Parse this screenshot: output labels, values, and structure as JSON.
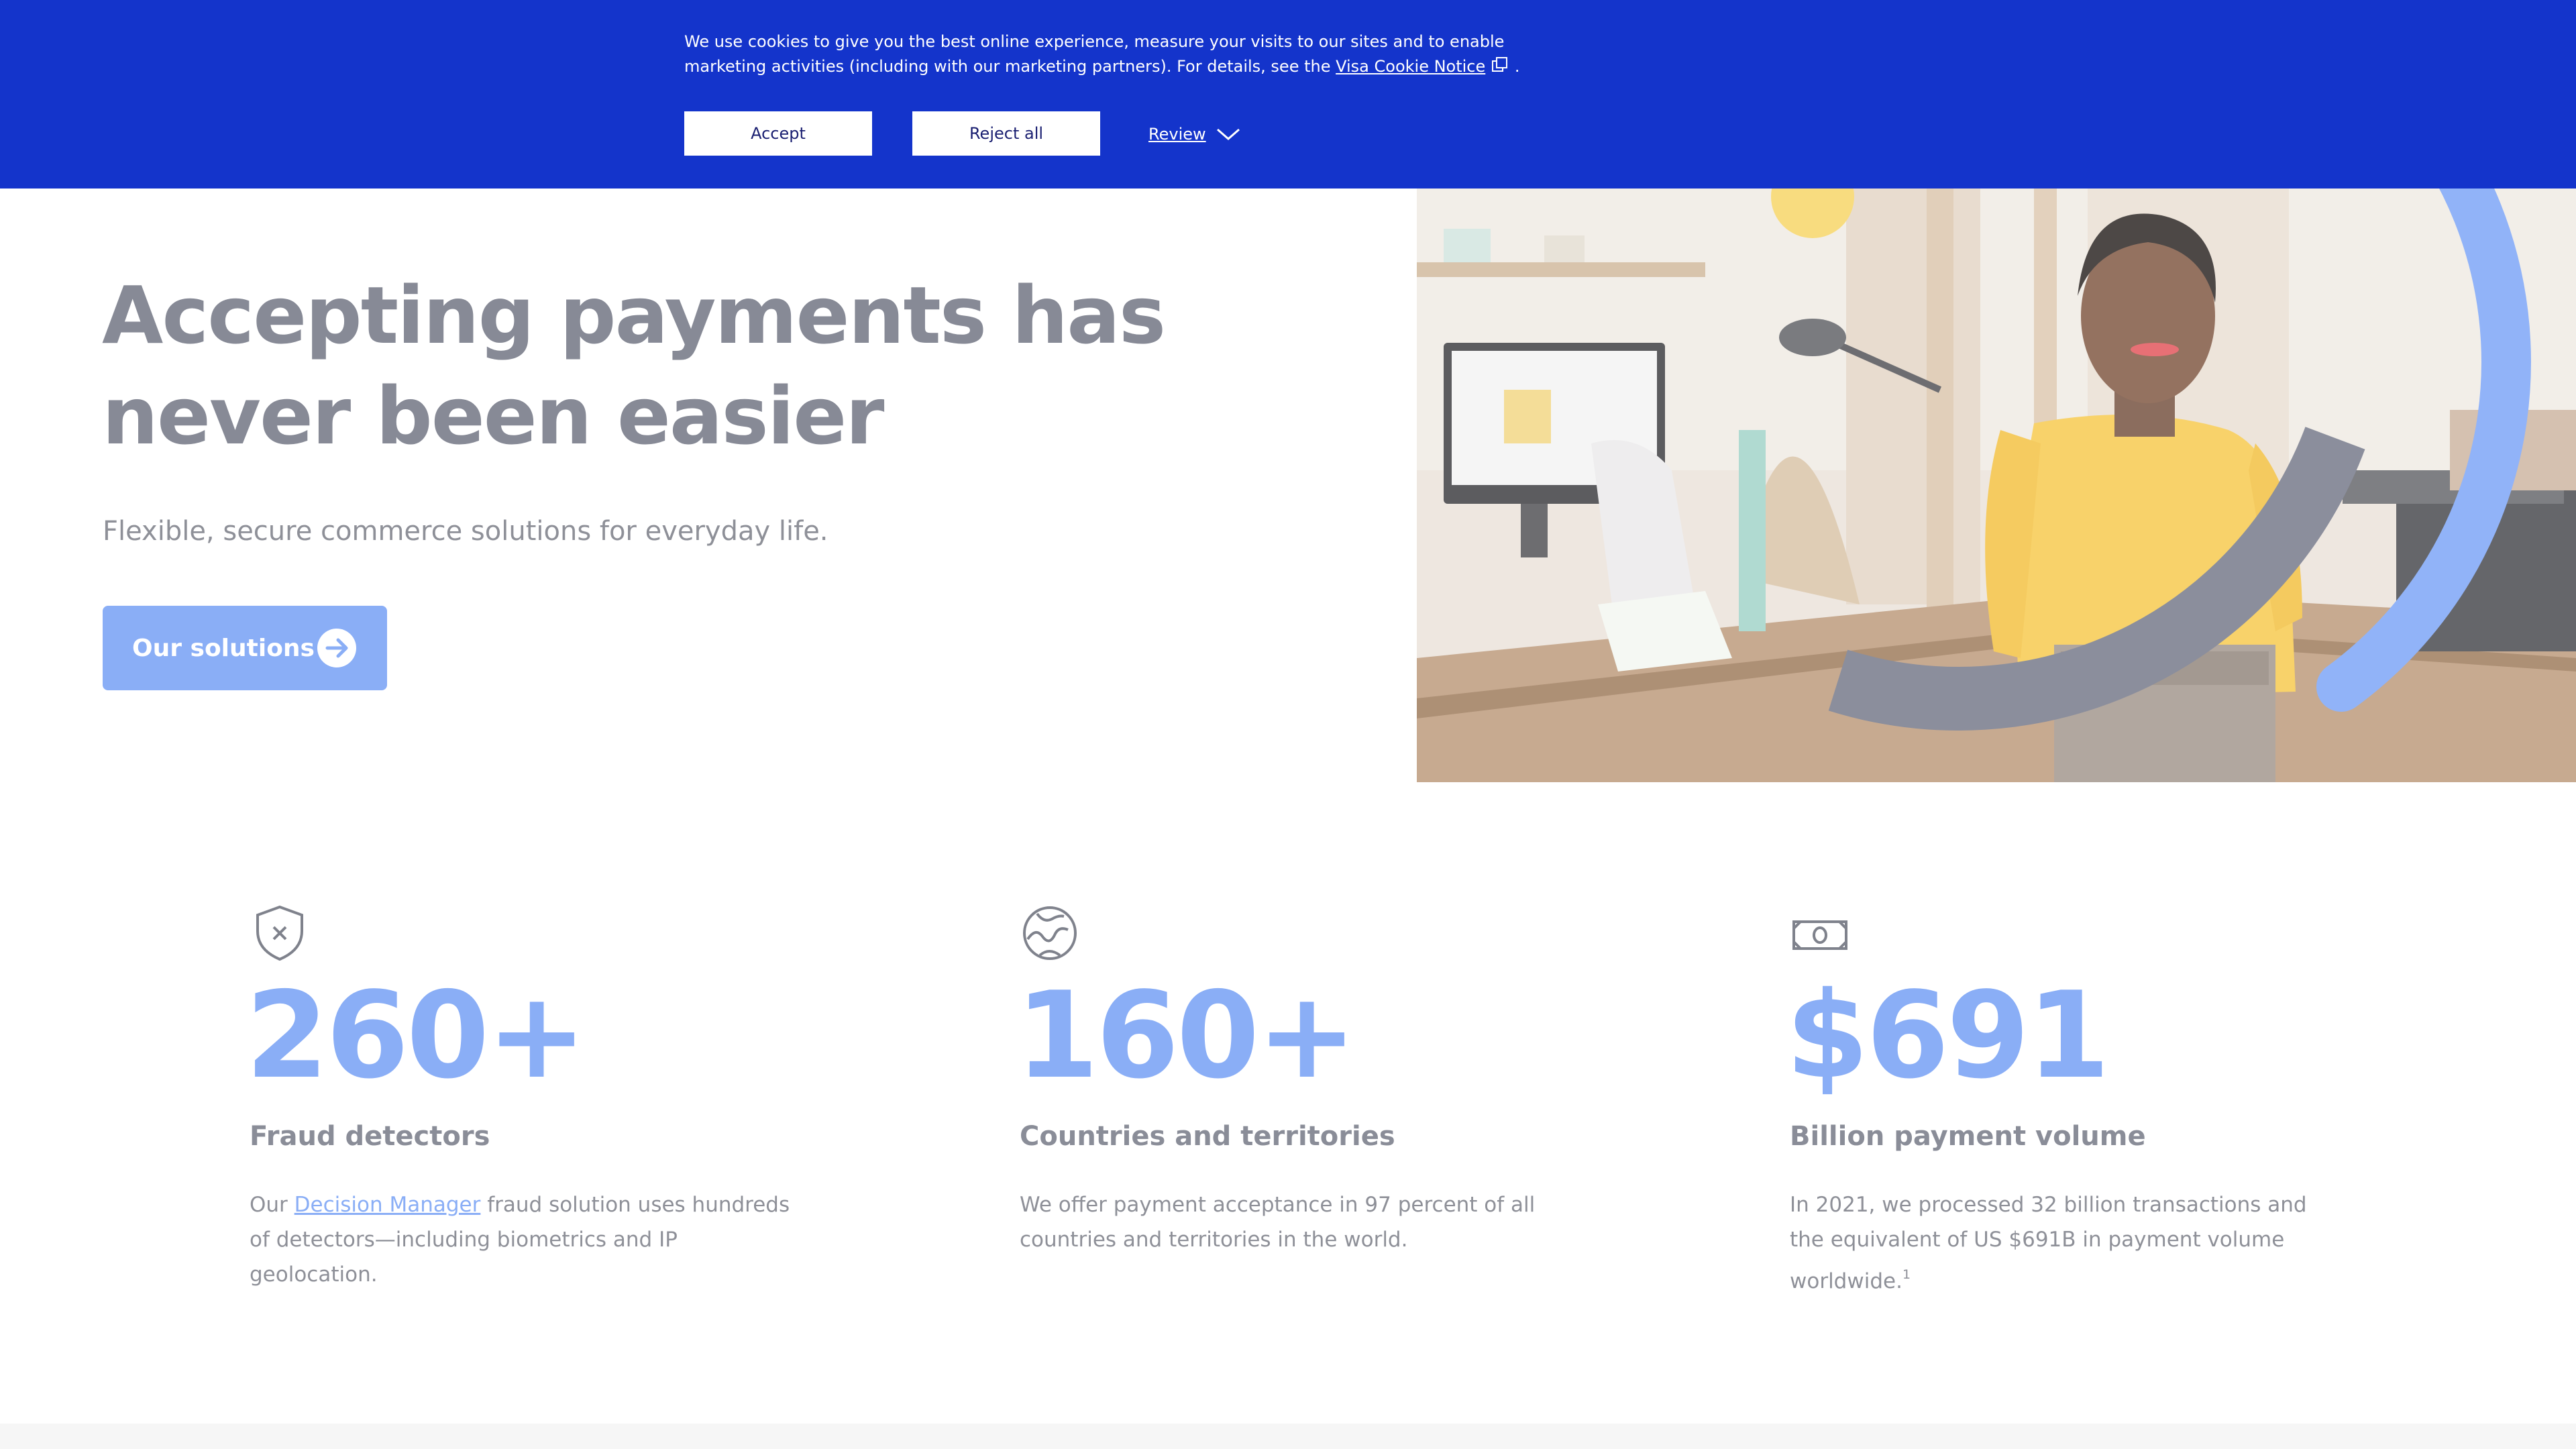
{
  "cookie_banner": {
    "text_before_link": "We use cookies to give you the best online experience, measure your visits to our sites and to enable marketing activities (including with our marketing partners). For details, see the ",
    "link_label": "Visa Cookie Notice",
    "text_after_link": " .",
    "accept_label": "Accept",
    "reject_label": "Reject all",
    "review_label": "Review"
  },
  "hero": {
    "title": "Accepting payments has never been easier",
    "subtitle": "Flexible, secure commerce solutions for everyday life.",
    "cta_label": "Our solutions"
  },
  "stats": [
    {
      "icon": "shield-x-icon",
      "value": "260+",
      "label": "Fraud detectors",
      "desc_before_link": "Our ",
      "desc_link": "Decision Manager",
      "desc_after_link": " fraud solution uses hundreds of detectors—including biometrics and IP geolocation."
    },
    {
      "icon": "globe-icon",
      "value": "160+",
      "label": "Countries and territories",
      "desc": "We offer payment acceptance in 97 percent of all countries and territories in the world."
    },
    {
      "icon": "banknote-icon",
      "value": "$691",
      "label": "Billion payment volume",
      "desc": "In 2021, we processed 32 billion transactions and the equivalent of US $691B in payment volume worldwide.",
      "footnote": "1"
    }
  ],
  "colors": {
    "banner_blue": "#1434cb",
    "accent_light_blue": "#8aaef6",
    "muted_gray": "#878a96"
  }
}
